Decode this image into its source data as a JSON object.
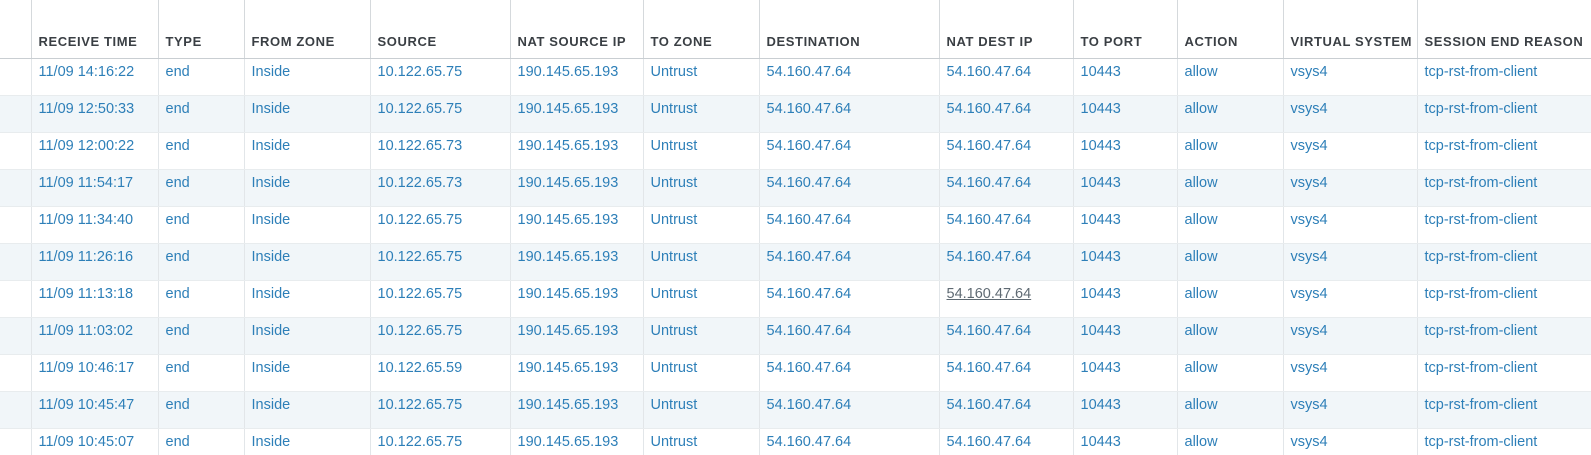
{
  "columns": [
    "RECEIVE TIME",
    "TYPE",
    "FROM ZONE",
    "SOURCE",
    "NAT SOURCE IP",
    "TO ZONE",
    "DESTINATION",
    "NAT DEST IP",
    "TO PORT",
    "ACTION",
    "VIRTUAL SYSTEM",
    "SESSION END REASON"
  ],
  "rows": [
    [
      "11/09 14:16:22",
      "end",
      "Inside",
      "10.122.65.75",
      "190.145.65.193",
      "Untrust",
      "54.160.47.64",
      "54.160.47.64",
      "10443",
      "allow",
      "vsys4",
      "tcp-rst-from-client"
    ],
    [
      "11/09 12:50:33",
      "end",
      "Inside",
      "10.122.65.75",
      "190.145.65.193",
      "Untrust",
      "54.160.47.64",
      "54.160.47.64",
      "10443",
      "allow",
      "vsys4",
      "tcp-rst-from-client"
    ],
    [
      "11/09 12:00:22",
      "end",
      "Inside",
      "10.122.65.73",
      "190.145.65.193",
      "Untrust",
      "54.160.47.64",
      "54.160.47.64",
      "10443",
      "allow",
      "vsys4",
      "tcp-rst-from-client"
    ],
    [
      "11/09 11:54:17",
      "end",
      "Inside",
      "10.122.65.73",
      "190.145.65.193",
      "Untrust",
      "54.160.47.64",
      "54.160.47.64",
      "10443",
      "allow",
      "vsys4",
      "tcp-rst-from-client"
    ],
    [
      "11/09 11:34:40",
      "end",
      "Inside",
      "10.122.65.75",
      "190.145.65.193",
      "Untrust",
      "54.160.47.64",
      "54.160.47.64",
      "10443",
      "allow",
      "vsys4",
      "tcp-rst-from-client"
    ],
    [
      "11/09 11:26:16",
      "end",
      "Inside",
      "10.122.65.75",
      "190.145.65.193",
      "Untrust",
      "54.160.47.64",
      "54.160.47.64",
      "10443",
      "allow",
      "vsys4",
      "tcp-rst-from-client"
    ],
    [
      "11/09 11:13:18",
      "end",
      "Inside",
      "10.122.65.75",
      "190.145.65.193",
      "Untrust",
      "54.160.47.64",
      "54.160.47.64",
      "10443",
      "allow",
      "vsys4",
      "tcp-rst-from-client"
    ],
    [
      "11/09 11:03:02",
      "end",
      "Inside",
      "10.122.65.75",
      "190.145.65.193",
      "Untrust",
      "54.160.47.64",
      "54.160.47.64",
      "10443",
      "allow",
      "vsys4",
      "tcp-rst-from-client"
    ],
    [
      "11/09 10:46:17",
      "end",
      "Inside",
      "10.122.65.59",
      "190.145.65.193",
      "Untrust",
      "54.160.47.64",
      "54.160.47.64",
      "10443",
      "allow",
      "vsys4",
      "tcp-rst-from-client"
    ],
    [
      "11/09 10:45:47",
      "end",
      "Inside",
      "10.122.65.75",
      "190.145.65.193",
      "Untrust",
      "54.160.47.64",
      "54.160.47.64",
      "10443",
      "allow",
      "vsys4",
      "tcp-rst-from-client"
    ],
    [
      "11/09 10:45:07",
      "end",
      "Inside",
      "10.122.65.75",
      "190.145.65.193",
      "Untrust",
      "54.160.47.64",
      "54.160.47.64",
      "10443",
      "allow",
      "vsys4",
      "tcp-rst-from-client"
    ]
  ],
  "colors": {
    "link": "#2d7fb8",
    "header_text": "#3a3f44",
    "row_alt": "#f1f6f9"
  }
}
